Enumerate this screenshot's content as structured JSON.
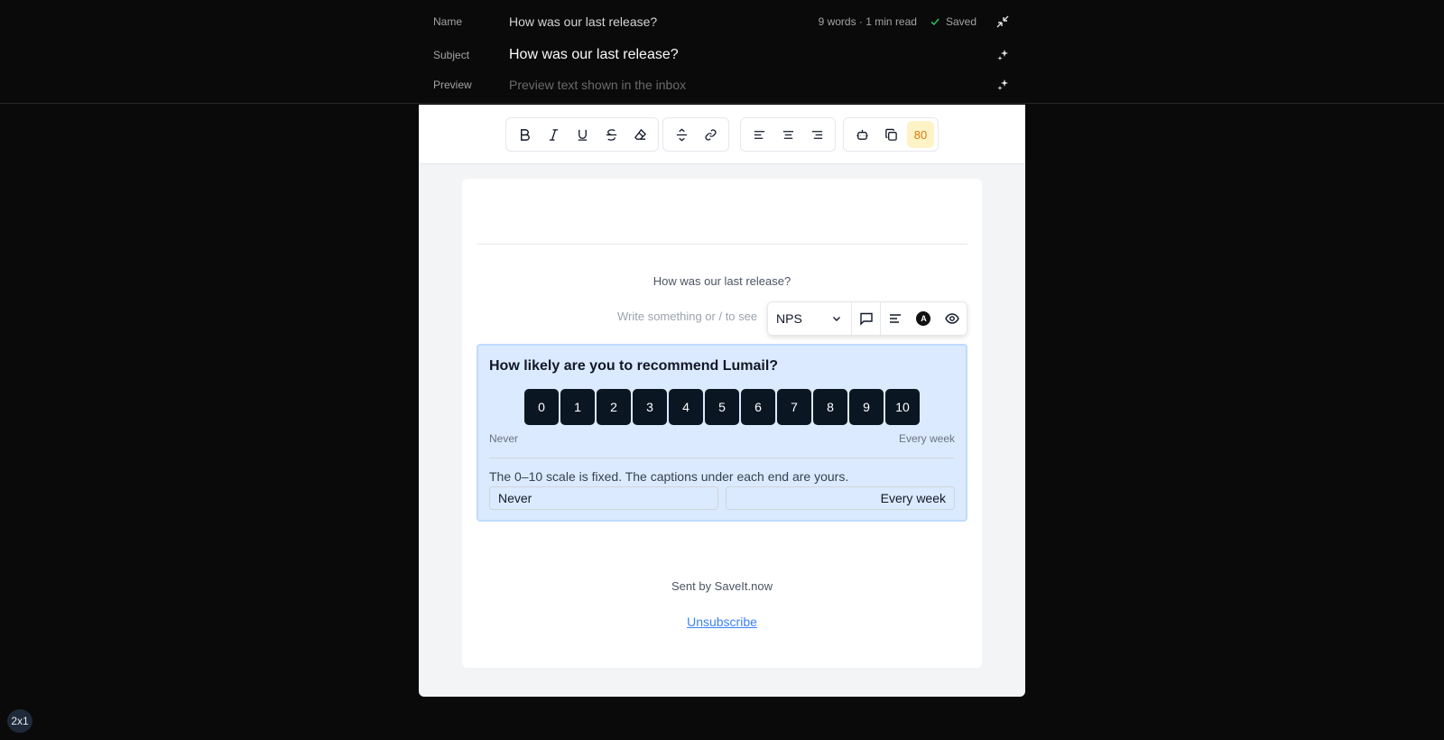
{
  "header": {
    "name_label": "Name",
    "name_value": "How was our last release?",
    "meta": "9 words · 1 min read",
    "saved": "Saved",
    "subject_label": "Subject",
    "subject_value": "How was our last release?",
    "preview_label": "Preview",
    "preview_placeholder": "Preview text shown in the inbox"
  },
  "toolbar": {
    "score": "80"
  },
  "email": {
    "title": "How was our last release?",
    "placeholder": "Write something or / to see",
    "nps": {
      "type_label": "NPS",
      "question": "How likely are you to recommend Lumail?",
      "scale": [
        "0",
        "1",
        "2",
        "3",
        "4",
        "5",
        "6",
        "7",
        "8",
        "9",
        "10"
      ],
      "caption_low": "Never",
      "caption_high": "Every week",
      "help": "The 0–10 scale is fixed. The captions under each end are yours.",
      "input_low": "Never",
      "input_high": "Every week"
    },
    "footer_sent": "Sent by SaveIt.now",
    "unsubscribe": "Unsubscribe"
  },
  "zoom": "2x1",
  "colors": {
    "accent": "#3b82f6",
    "score_bg": "#fef3c7",
    "score_text": "#d97706",
    "nps_bg": "#dbeafe",
    "scale_btn": "#0b1623"
  }
}
